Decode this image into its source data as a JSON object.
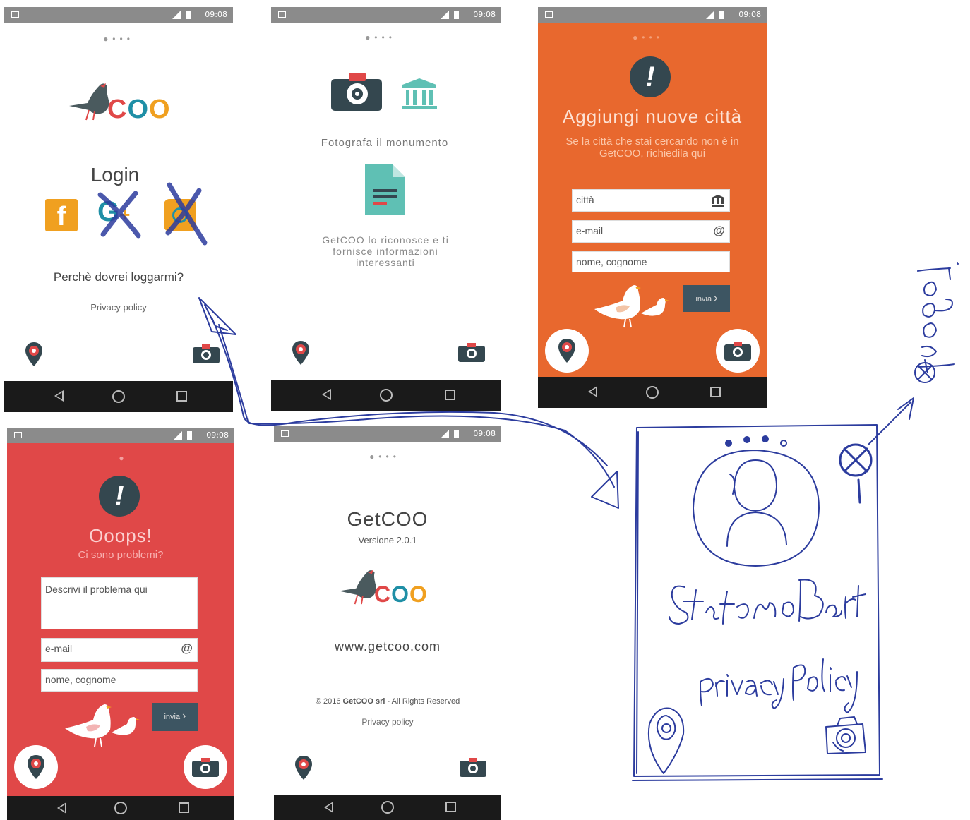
{
  "status": {
    "time": "09:08"
  },
  "screen_login": {
    "logo_text": "COO",
    "title": "Login",
    "why_login": "Perchè dovrei loggarmi?",
    "privacy": "Privacy policy"
  },
  "screen_photo": {
    "caption": "Fotografa il monumento",
    "description": "GetCOO lo riconosce e ti fornisce informazioni interessanti"
  },
  "screen_add_city": {
    "title": "Aggiungi nuove città",
    "subtitle": "Se la città che stai cercando non è in GetCOO, richiedila qui",
    "city_placeholder": "città",
    "email_placeholder": "e-mail",
    "email_suffix": "@",
    "name_placeholder": "nome, cognome",
    "send_label": "invia"
  },
  "screen_oops": {
    "title": "Ooops!",
    "subtitle": "Ci sono problemi?",
    "problem_placeholder": "Descrivi il problema qui",
    "email_placeholder": "e-mail",
    "email_suffix": "@",
    "name_placeholder": "nome, cognome",
    "send_label": "invia"
  },
  "screen_about": {
    "app_name": "GetCOO",
    "version": "Versione 2.0.1",
    "logo_text": "COO",
    "website": "www.getcoo.com",
    "copyright_pre": "© 2016 ",
    "copyright_company": "GetCOO srl",
    "copyright_post": " - All Rights Reserved",
    "privacy": "Privacy policy"
  },
  "sketch": {
    "user_name": "Stefano Bart",
    "privacy": "privacy policy",
    "logout": "logout"
  },
  "colors": {
    "orange": "#e8682e",
    "red": "#e04848",
    "dark_teal": "#34474f",
    "teal": "#5fc0b4",
    "logo_red": "#e04848",
    "logo_teal": "#1f8fa6",
    "logo_orange": "#f0a020",
    "pen_blue": "#2c3c9e"
  }
}
